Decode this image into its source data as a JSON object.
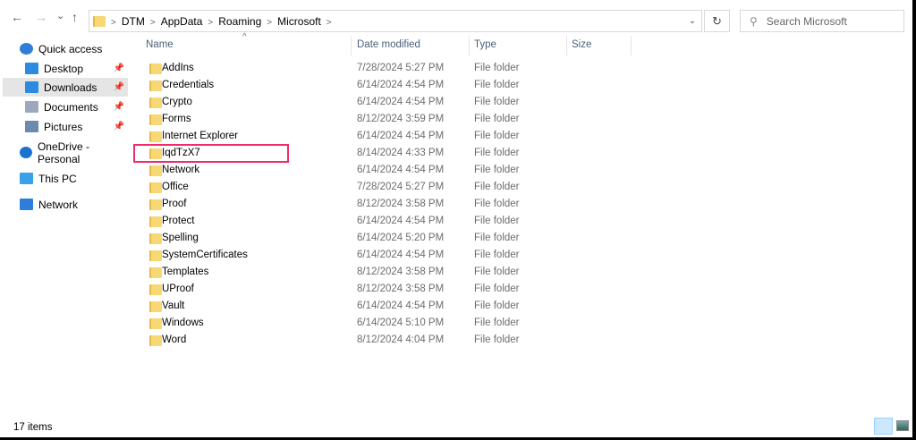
{
  "nav": {
    "back": "←",
    "forward": "→",
    "recent": "⌄",
    "up": "↑"
  },
  "breadcrumb": [
    "DTM",
    "AppData",
    "Roaming",
    "Microsoft"
  ],
  "search": {
    "placeholder": "Search Microsoft"
  },
  "sidebar": [
    {
      "label": "Quick access",
      "icon": "star-icon"
    },
    {
      "label": "Desktop",
      "icon": "desktop-icon",
      "pinned": true
    },
    {
      "label": "Downloads",
      "icon": "download-icon",
      "pinned": true,
      "selected": true
    },
    {
      "label": "Documents",
      "icon": "documents-icon",
      "pinned": true
    },
    {
      "label": "Pictures",
      "icon": "pictures-icon",
      "pinned": true
    },
    {
      "label": "OneDrive - Personal",
      "icon": "cloud-icon"
    },
    {
      "label": "This PC",
      "icon": "pc-icon"
    },
    {
      "label": "Network",
      "icon": "network-icon"
    }
  ],
  "columns": {
    "name": "Name",
    "date": "Date modified",
    "type": "Type",
    "size": "Size"
  },
  "files": [
    {
      "name": "AddIns",
      "date": "7/28/2024 5:27 PM",
      "type": "File folder"
    },
    {
      "name": "Credentials",
      "date": "6/14/2024 4:54 PM",
      "type": "File folder"
    },
    {
      "name": "Crypto",
      "date": "6/14/2024 4:54 PM",
      "type": "File folder"
    },
    {
      "name": "Forms",
      "date": "8/12/2024 3:59 PM",
      "type": "File folder"
    },
    {
      "name": "Internet Explorer",
      "date": "6/14/2024 4:54 PM",
      "type": "File folder"
    },
    {
      "name": "IqdTzX7",
      "date": "8/14/2024 4:33 PM",
      "type": "File folder"
    },
    {
      "name": "Network",
      "date": "6/14/2024 4:54 PM",
      "type": "File folder"
    },
    {
      "name": "Office",
      "date": "7/28/2024 5:27 PM",
      "type": "File folder"
    },
    {
      "name": "Proof",
      "date": "8/12/2024 3:58 PM",
      "type": "File folder"
    },
    {
      "name": "Protect",
      "date": "6/14/2024 4:54 PM",
      "type": "File folder"
    },
    {
      "name": "Spelling",
      "date": "6/14/2024 5:20 PM",
      "type": "File folder"
    },
    {
      "name": "SystemCertificates",
      "date": "6/14/2024 4:54 PM",
      "type": "File folder"
    },
    {
      "name": "Templates",
      "date": "8/12/2024 3:58 PM",
      "type": "File folder"
    },
    {
      "name": "UProof",
      "date": "8/12/2024 3:58 PM",
      "type": "File folder"
    },
    {
      "name": "Vault",
      "date": "6/14/2024 4:54 PM",
      "type": "File folder"
    },
    {
      "name": "Windows",
      "date": "6/14/2024 5:10 PM",
      "type": "File folder"
    },
    {
      "name": "Word",
      "date": "8/12/2024 4:04 PM",
      "type": "File folder"
    }
  ],
  "status": "17 items"
}
